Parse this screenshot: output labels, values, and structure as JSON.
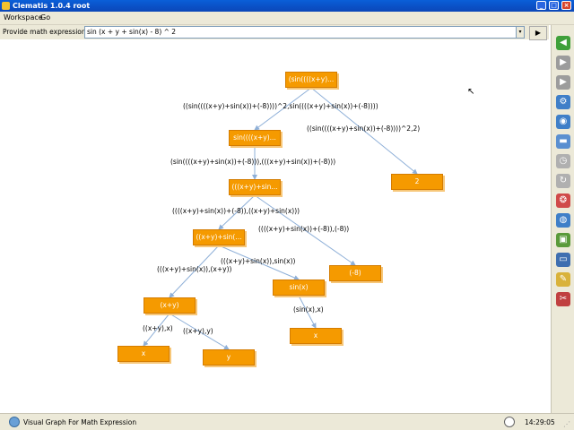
{
  "window": {
    "title": "Clematis 1.0.4 root",
    "minimize": "_",
    "maximize": "□",
    "close": "×"
  },
  "menu": {
    "workspace": "Workspace",
    "go": "Go"
  },
  "expression_bar": {
    "label": "Provide math expression here:",
    "value": "sin (x + y + sin(x) - 8) ^ 2",
    "dropdown_glyph": "▾",
    "run_glyph": "▶"
  },
  "graph": {
    "nodes": [
      {
        "id": "n0",
        "label": "(sin((((x+y)..."
      },
      {
        "id": "n1",
        "label": "sin((((x+y)..."
      },
      {
        "id": "n2",
        "label": "2"
      },
      {
        "id": "n3",
        "label": "(((x+y)+sin..."
      },
      {
        "id": "n4",
        "label": "((x+y)+sin(..."
      },
      {
        "id": "n5",
        "label": "(-8)"
      },
      {
        "id": "n6",
        "label": "(x+y)"
      },
      {
        "id": "n7",
        "label": "sin(x)"
      },
      {
        "id": "n8",
        "label": "x"
      },
      {
        "id": "n9",
        "label": "y"
      },
      {
        "id": "n10",
        "label": "x"
      }
    ],
    "edge_labels": [
      "((sin((((x+y)+sin(x))+(-8))))^2,sin((((x+y)+sin(x))+(-8))))",
      "((sin((((x+y)+sin(x))+(-8))))^2,2)",
      "(sin((((x+y)+sin(x))+(-8))),(((x+y)+sin(x))+(-8)))",
      "((((x+y)+sin(x))+(-8)),((x+y)+sin(x)))",
      "((((x+y)+sin(x))+(-8)),(-8))",
      "(((x+y)+sin(x)),sin(x))",
      "(((x+y)+sin(x)),(x+y))",
      "((x+y),x)",
      "((x+y),y)",
      "(sin(x),x)"
    ]
  },
  "toolbar": [
    {
      "icon": "back-arrow-icon",
      "color": "#3fa03a",
      "glyph": "◀"
    },
    {
      "icon": "forward-arrow-icon",
      "color": "#9c9c9c",
      "glyph": "▶"
    },
    {
      "icon": "gray-arrow-icon",
      "color": "#9c9c9c",
      "glyph": "▶"
    },
    {
      "icon": "network-icon",
      "color": "#3f7fc8",
      "glyph": "⚙"
    },
    {
      "icon": "globe-icon",
      "color": "#3f7fc8",
      "glyph": "◉"
    },
    {
      "icon": "disk-icon",
      "color": "#5a8fd0",
      "glyph": "▬"
    },
    {
      "icon": "clock-icon",
      "color": "#b0b0b0",
      "glyph": "◷"
    },
    {
      "icon": "refresh-icon",
      "color": "#b0b0b0",
      "glyph": "↻"
    },
    {
      "icon": "color-wheel-icon",
      "color": "#d04a4a",
      "glyph": "❂"
    },
    {
      "icon": "world-icon",
      "color": "#3f7fc8",
      "glyph": "◍"
    },
    {
      "icon": "image-icon",
      "color": "#5a9a3a",
      "glyph": "▣"
    },
    {
      "icon": "window-icon",
      "color": "#3f6fb0",
      "glyph": "▭"
    },
    {
      "icon": "pencil-icon",
      "color": "#d9b23a",
      "glyph": "✎"
    },
    {
      "icon": "tools-icon",
      "color": "#c04040",
      "glyph": "✂"
    }
  ],
  "status": {
    "text": "Visual Graph For Math Expression",
    "time": "14:29:05"
  }
}
